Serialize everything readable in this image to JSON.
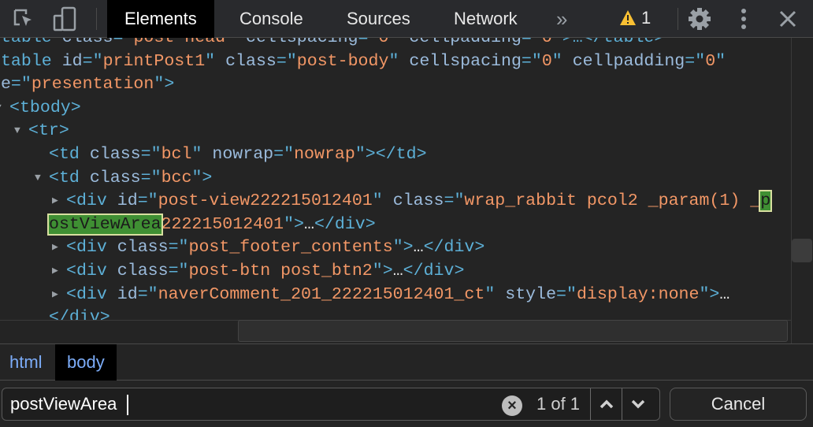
{
  "toolbar": {
    "tabs": [
      "Elements",
      "Console",
      "Sources",
      "Network"
    ],
    "active_tab": "Elements",
    "more_label": "»",
    "warning_count": "1",
    "warning_color": "#f9c033"
  },
  "code_lines": [
    {
      "indent": 0,
      "tokens": [
        [
          "t",
          "<table "
        ],
        [
          "a",
          "class"
        ],
        [
          "t",
          "=\""
        ],
        [
          "v",
          "post-head"
        ],
        [
          "t",
          "\" "
        ],
        [
          "a",
          "cellspacing"
        ],
        [
          "t",
          "=\""
        ],
        [
          "v",
          "0"
        ],
        [
          "t",
          "\" "
        ],
        [
          "a",
          "cellpadding"
        ],
        [
          "t",
          "=\""
        ],
        [
          "v",
          "0"
        ],
        [
          "t",
          "\">…</table>"
        ]
      ]
    },
    {
      "indent": 0,
      "tokens": [
        [
          "t",
          "<table "
        ],
        [
          "a",
          "id"
        ],
        [
          "t",
          "=\""
        ],
        [
          "v",
          "printPost1"
        ],
        [
          "t",
          "\" "
        ],
        [
          "a",
          "class"
        ],
        [
          "t",
          "=\""
        ],
        [
          "v",
          "post-body"
        ],
        [
          "t",
          "\" "
        ],
        [
          "a",
          "cellspacing"
        ],
        [
          "t",
          "=\""
        ],
        [
          "v",
          "0"
        ],
        [
          "t",
          "\" "
        ],
        [
          "a",
          "cellpadding"
        ],
        [
          "t",
          "=\""
        ],
        [
          "v",
          "0"
        ],
        [
          "t",
          "\""
        ]
      ]
    },
    {
      "indent": 0,
      "tokens": [
        [
          "a",
          "le"
        ],
        [
          "t",
          "=\""
        ],
        [
          "v",
          "presentation"
        ],
        [
          "t",
          "\">"
        ]
      ]
    },
    {
      "indent": 1,
      "tri": "open",
      "tokens": [
        [
          "t",
          "<tbody>"
        ]
      ]
    },
    {
      "indent": 2,
      "tri": "open",
      "tokens": [
        [
          "t",
          "<tr>"
        ]
      ]
    },
    {
      "indent": 3,
      "tokens": [
        [
          "t",
          "<td "
        ],
        [
          "a",
          "class"
        ],
        [
          "t",
          "=\""
        ],
        [
          "v",
          "bcl"
        ],
        [
          "t",
          "\" "
        ],
        [
          "a",
          "nowrap"
        ],
        [
          "t",
          "=\""
        ],
        [
          "v",
          "nowrap"
        ],
        [
          "t",
          "\"></td>"
        ]
      ]
    },
    {
      "indent": 3,
      "tri": "open",
      "tokens": [
        [
          "t",
          "<td "
        ],
        [
          "a",
          "class"
        ],
        [
          "t",
          "=\""
        ],
        [
          "v",
          "bcc"
        ],
        [
          "t",
          "\">"
        ]
      ]
    },
    {
      "indent": 4,
      "tri": "closed",
      "tokens": [
        [
          "t",
          "<div "
        ],
        [
          "a",
          "id"
        ],
        [
          "t",
          "=\""
        ],
        [
          "v",
          "post-view222215012401"
        ],
        [
          "t",
          "\" "
        ],
        [
          "a",
          "class"
        ],
        [
          "t",
          "=\""
        ],
        [
          "v",
          "wrap_rabbit pcol2 _param(1) _"
        ],
        [
          "hl",
          "p"
        ]
      ]
    },
    {
      "indent": 3,
      "tokens": [
        [
          "hl",
          "ostViewArea"
        ],
        [
          "v",
          "222215012401"
        ],
        [
          "t",
          "\">"
        ],
        [
          "x",
          "…"
        ],
        [
          "t",
          "</div>"
        ]
      ]
    },
    {
      "indent": 4,
      "tri": "closed",
      "tokens": [
        [
          "t",
          "<div "
        ],
        [
          "a",
          "class"
        ],
        [
          "t",
          "=\""
        ],
        [
          "v",
          "post_footer_contents"
        ],
        [
          "t",
          "\">"
        ],
        [
          "x",
          "…"
        ],
        [
          "t",
          "</div>"
        ]
      ]
    },
    {
      "indent": 4,
      "tri": "closed",
      "tokens": [
        [
          "t",
          "<div "
        ],
        [
          "a",
          "class"
        ],
        [
          "t",
          "=\""
        ],
        [
          "v",
          "post-btn post_btn2"
        ],
        [
          "t",
          "\">"
        ],
        [
          "x",
          "…"
        ],
        [
          "t",
          "</div>"
        ]
      ]
    },
    {
      "indent": 4,
      "tri": "closed",
      "tokens": [
        [
          "t",
          "<div "
        ],
        [
          "a",
          "id"
        ],
        [
          "t",
          "=\""
        ],
        [
          "v",
          "naverComment_201_222215012401_ct"
        ],
        [
          "t",
          "\" "
        ],
        [
          "a",
          "style"
        ],
        [
          "t",
          "=\""
        ],
        [
          "v",
          "display:none"
        ],
        [
          "t",
          "\">"
        ],
        [
          "x",
          "…"
        ]
      ]
    },
    {
      "indent": 3,
      "tokens": [
        [
          "t",
          "</div>"
        ]
      ]
    }
  ],
  "breadcrumbs": [
    "html",
    "body"
  ],
  "search": {
    "value": "postViewArea",
    "match_count": "1 of 1",
    "cancel_label": "Cancel"
  }
}
